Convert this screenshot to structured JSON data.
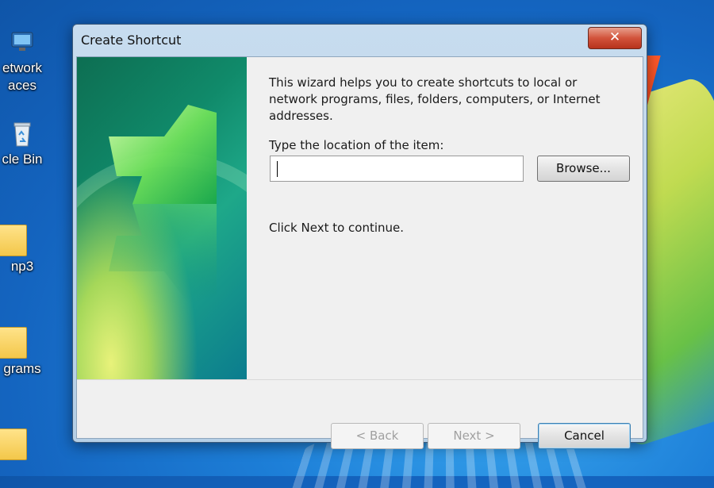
{
  "desktop": {
    "icons": [
      {
        "label": "etwork",
        "label2": "aces"
      },
      {
        "label": "cle Bin"
      },
      {
        "label": "np3"
      },
      {
        "label": "grams"
      }
    ]
  },
  "dialog": {
    "title": "Create Shortcut",
    "close_label": "✕",
    "intro": "This wizard helps you to create shortcuts to local or network programs, files, folders, computers, or Internet addresses.",
    "field_label": "Type the location of the item:",
    "location_value": "",
    "browse_label": "Browse...",
    "hint": "Click Next to continue.",
    "back_label": "< Back",
    "next_label": "Next >",
    "cancel_label": "Cancel"
  },
  "colors": {
    "desktop_blue": "#1d7fd8",
    "close_red": "#d2533b",
    "banner_green": "#108a6a"
  }
}
